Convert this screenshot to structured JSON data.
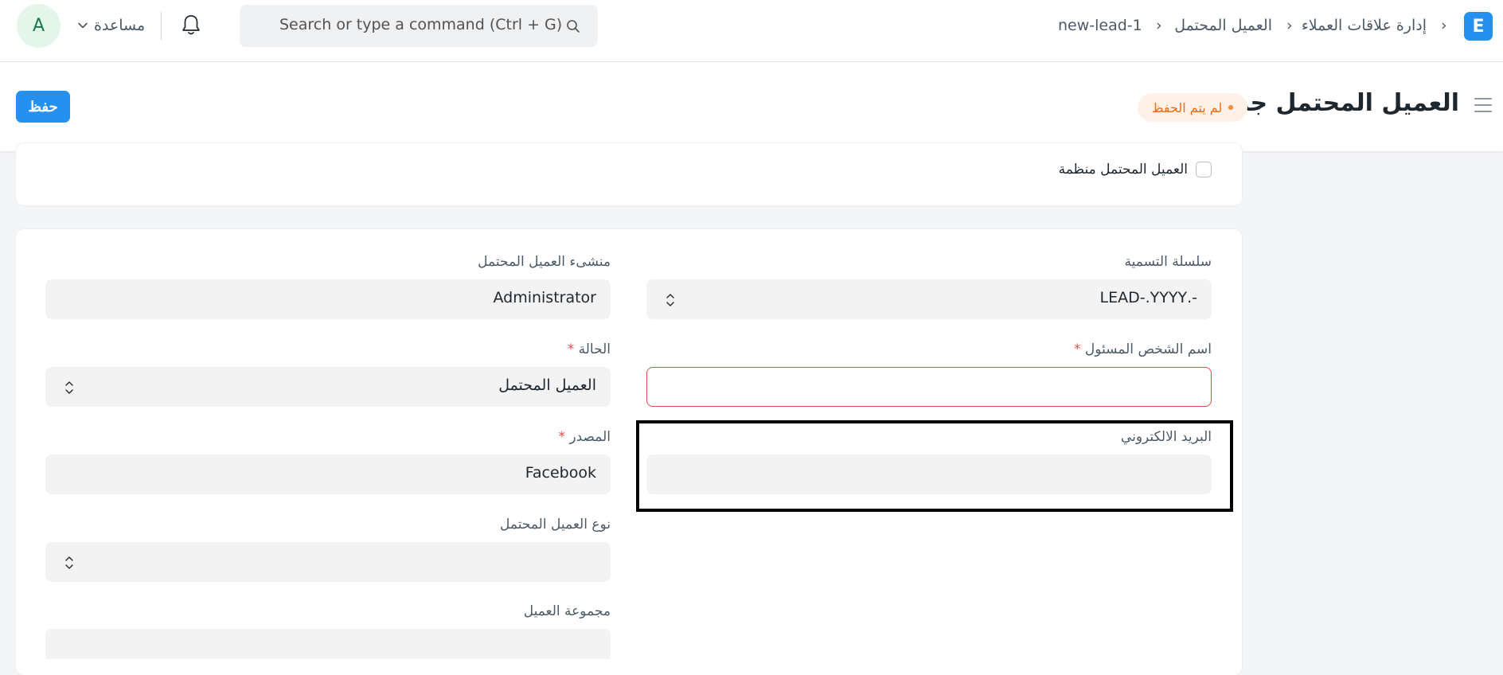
{
  "navbar": {
    "logo_letter": "E",
    "breadcrumbs": [
      "إدارة علاقات العملاء",
      "العميل المحتمل",
      "new-lead-1"
    ],
    "breadcrumb_separator": "›",
    "search": {
      "placeholder": "Search or type a command (Ctrl + G)"
    },
    "help_label": "مساعدة",
    "avatar_letter": "A",
    "icons": [
      "search-icon",
      "bell-icon",
      "chevron-down-icon"
    ]
  },
  "page_head": {
    "title": "العميل المحتمل جديد",
    "status_badge": "لم يتم الحفظ",
    "save_label": "حفظ",
    "icons": [
      "hamburger-icon"
    ]
  },
  "form": {
    "organization_checkbox": {
      "label": "العميل المحتمل منظمة",
      "checked": false
    },
    "naming_series": {
      "label": "سلسلة التسمية",
      "value": "-.LEAD-.YYYY"
    },
    "lead_owner": {
      "label": "منشىء العميل المحتمل",
      "value": "Administrator"
    },
    "person_name": {
      "label": "اسم الشخص المسئول",
      "required_mark": "*",
      "value": ""
    },
    "status": {
      "label": "الحالة",
      "required_mark": "*",
      "value": "العميل المحتمل"
    },
    "email": {
      "label": "البريد الالكتروني",
      "value": ""
    },
    "source": {
      "label": "المصدر",
      "required_mark": "*",
      "value": "Facebook"
    },
    "lead_type": {
      "label": "نوع العميل المحتمل",
      "value": ""
    },
    "customer_group": {
      "label": "مجموعة العميل",
      "value": ""
    }
  },
  "colors": {
    "primary": "#2490ef",
    "error": "#e24c4c",
    "badge_text": "#e86c13",
    "badge_bg": "#fff1e7"
  }
}
